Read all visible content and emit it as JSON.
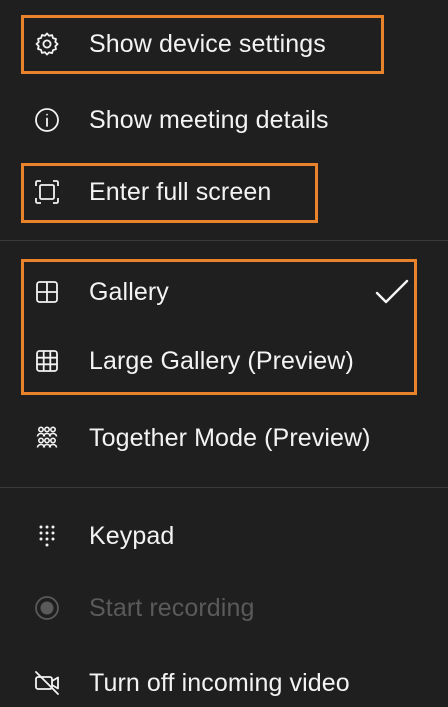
{
  "menu": {
    "items": [
      {
        "label": "Show device settings",
        "icon": "gear-icon"
      },
      {
        "label": "Show meeting details",
        "icon": "info-icon"
      },
      {
        "label": "Enter full screen",
        "icon": "fullscreen-icon"
      },
      {
        "label": "Gallery",
        "icon": "gallery-icon",
        "checked": true
      },
      {
        "label": "Large Gallery (Preview)",
        "icon": "large-gallery-icon"
      },
      {
        "label": "Together Mode (Preview)",
        "icon": "together-mode-icon"
      },
      {
        "label": "Keypad",
        "icon": "keypad-icon"
      },
      {
        "label": "Start recording",
        "icon": "record-icon",
        "disabled": true
      },
      {
        "label": "Turn off incoming video",
        "icon": "video-off-icon"
      }
    ]
  },
  "colors": {
    "background": "#1f1f1f",
    "text": "#f3f3f3",
    "disabled_text": "#5a5a5a",
    "highlight": "#e8832c",
    "divider": "#3b3b3b"
  }
}
